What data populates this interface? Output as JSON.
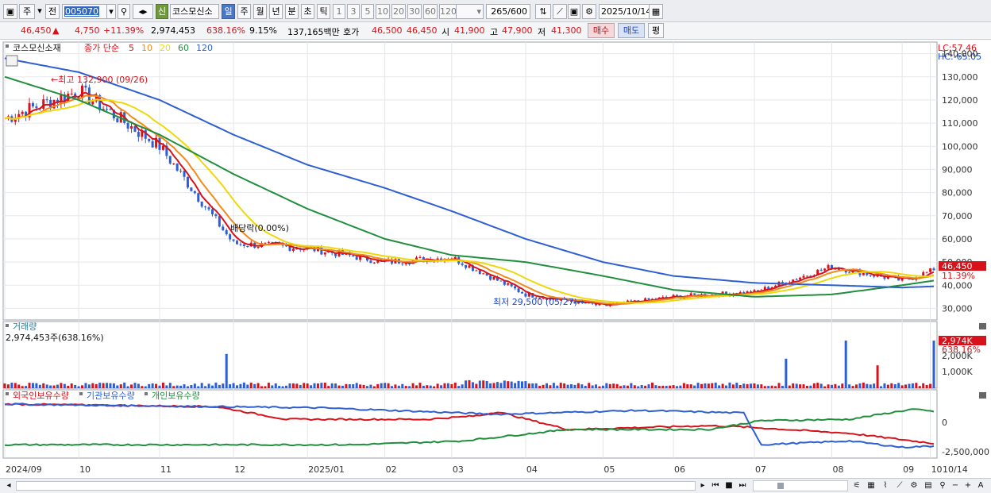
{
  "toolbar": {
    "market": "주",
    "prev": "전",
    "code": "005070",
    "status_new": "신",
    "name": "코스모신소",
    "periods": [
      "일",
      "주",
      "월",
      "년",
      "분",
      "초",
      "틱"
    ],
    "intervals": [
      "1",
      "3",
      "5",
      "10",
      "20",
      "30",
      "60",
      "120"
    ],
    "count": "265",
    "count_total": "/600",
    "date": "2025/10/14"
  },
  "quote": {
    "price": "46,450",
    "arrow": "▲",
    "change": "4,750",
    "change_pct": "+11.39%",
    "volume": "2,974,453",
    "vol_ratio": "638.16%",
    "turnover": "9.15%",
    "amount": "137,165백만",
    "ask_label": "호가",
    "ask": "46,500",
    "bid": "46,450",
    "open_label": "시",
    "open": "41,900",
    "high_label": "고",
    "high": "47,900",
    "low_label": "저",
    "low": "41,300",
    "buy": "매수",
    "sell": "매도",
    "avg": "평"
  },
  "chart": {
    "legend_name": "코스모신소재",
    "legend_price": "종가 단순",
    "ma_periods": [
      "5",
      "10",
      "20",
      "60",
      "120"
    ],
    "ma_colors": [
      "#d8121a",
      "#f08c1c",
      "#eed80a",
      "#1f8f3e",
      "#2d5fd3"
    ],
    "lc": "LC:57.46",
    "hc": "HC:-65.05",
    "high_note": "←최고 132,900 (09/26)",
    "low_note": "최저 29,500 (05/27)→",
    "dividend_note": "배당락(0.00%)",
    "price_ticks": [
      "140,000",
      "130,000",
      "120,000",
      "110,000",
      "100,000",
      "90,000",
      "80,000",
      "70,000",
      "60,000",
      "50,000",
      "40,000",
      "30,000"
    ],
    "last_price": "46,450",
    "last_pct": "11.39%"
  },
  "volume": {
    "title": "거래량",
    "value": "2,974,453주(638.16%)",
    "ticks": [
      "2,000K",
      "1,000K"
    ],
    "last": "2,974K",
    "last_pct": "638.16%"
  },
  "holdings": {
    "series": [
      "외국인보유수량",
      "기관보유수량",
      "개인보유수량"
    ],
    "colors": [
      "#d8121a",
      "#2d5fd3",
      "#1f8f3e"
    ],
    "ticks": [
      "0",
      "-2,500,000"
    ]
  },
  "xaxis": {
    "labels": [
      "2024/09",
      "10",
      "11",
      "12",
      "2025/01",
      "02",
      "03",
      "04",
      "05",
      "06",
      "07",
      "08",
      "09",
      "10"
    ],
    "current": "10/14"
  },
  "chart_data": {
    "type": "line",
    "title": "코스모신소재",
    "price_range": [
      25000,
      145000
    ],
    "series": [
      {
        "name": "종가",
        "x": [
          "2024/09",
          "2024/10",
          "2024/11",
          "2024/12",
          "2025/01",
          "2025/02",
          "2025/03",
          "2025/04",
          "2025/05",
          "2025/06",
          "2025/07",
          "2025/08",
          "2025/09",
          "2025/10/14"
        ],
        "values": [
          112000,
          124000,
          100000,
          58000,
          56000,
          50000,
          52000,
          36000,
          31000,
          35000,
          37000,
          48000,
          42000,
          46450
        ]
      },
      {
        "name": "120",
        "values": [
          138000,
          132000,
          120000,
          105000,
          92000,
          82000,
          72000,
          60000,
          50000,
          44000,
          41000,
          40000,
          39000,
          39500
        ]
      },
      {
        "name": "60",
        "values": [
          130000,
          120000,
          105000,
          88000,
          73000,
          60000,
          53000,
          50000,
          44000,
          38000,
          35000,
          36000,
          40000,
          42000
        ]
      }
    ],
    "volume": {
      "max": 2974453,
      "spike_dates": [
        "2024/11",
        "2025/06",
        "2025/08",
        "2025/10/14"
      ]
    }
  }
}
